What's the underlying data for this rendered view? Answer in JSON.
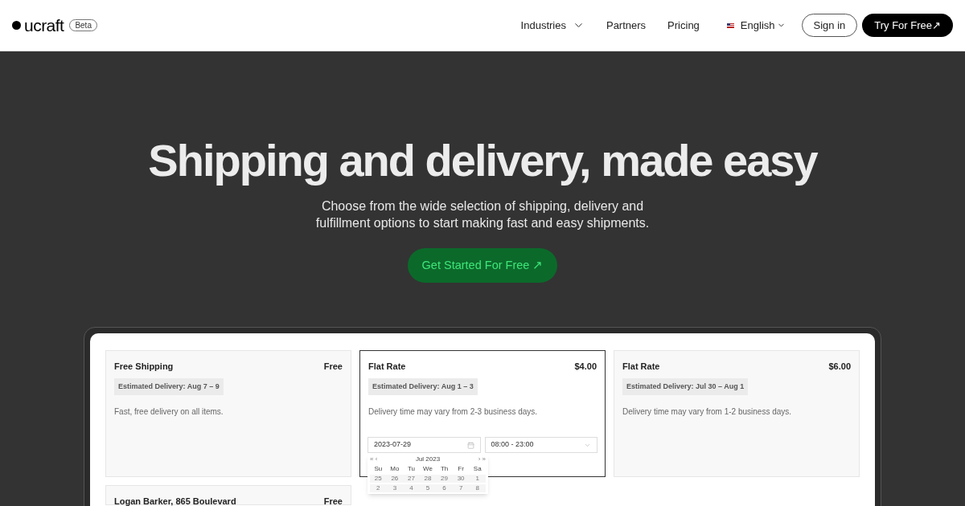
{
  "header": {
    "logo": "ucraft",
    "badge": "Beta",
    "nav": [
      {
        "label": "Industries",
        "has_menu": true
      },
      {
        "label": "Partners",
        "has_menu": false
      },
      {
        "label": "Pricing",
        "has_menu": false
      }
    ],
    "language": "English",
    "sign_in": "Sign in",
    "try_free": "Try For Free↗"
  },
  "hero": {
    "title": "Shipping and delivery, made easy",
    "subtitle": "Choose from the wide selection of shipping, delivery and fulfillment options to start making fast and easy shipments.",
    "cta": "Get Started For Free ↗"
  },
  "options": [
    {
      "name": "Free Shipping",
      "price": "Free",
      "estimate": "Estimated Delivery: Aug 7 – 9",
      "description": "Fast, free delivery on all items.",
      "selected": false
    },
    {
      "name": "Flat Rate",
      "price": "$4.00",
      "estimate": "Estimated Delivery: Aug 1 – 3",
      "description": "Delivery time may vary from 2-3 business days.",
      "selected": true,
      "date": "2023-07-29",
      "time": "08:00 - 23:00"
    },
    {
      "name": "Flat Rate",
      "price": "$6.00",
      "estimate": "Estimated Delivery: Jul 30 – Aug 1",
      "description": "Delivery time may vary from 1-2 business days.",
      "selected": false
    },
    {
      "name": "Logan Barker, 865 Boulevard",
      "price": "Free",
      "selected": false
    }
  ],
  "calendar": {
    "prev": "« ‹",
    "month": "Jul 2023",
    "next": "› »",
    "weekdays": [
      "Su",
      "Mo",
      "Tu",
      "We",
      "Th",
      "Fr",
      "Sa"
    ],
    "weeks": [
      [
        "25",
        "26",
        "27",
        "28",
        "29",
        "30",
        "1"
      ],
      [
        "2",
        "3",
        "4",
        "5",
        "6",
        "7",
        "8"
      ]
    ]
  }
}
